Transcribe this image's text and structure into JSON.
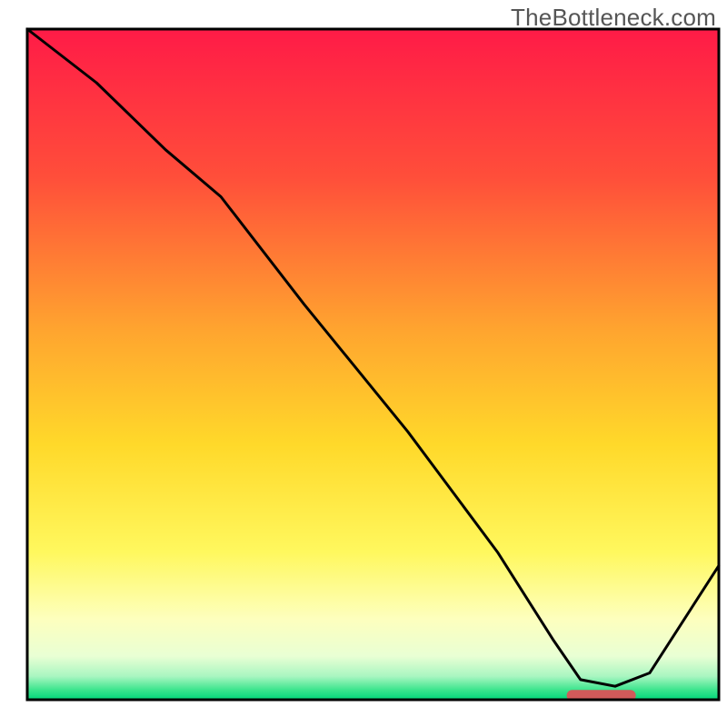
{
  "watermark": "TheBottleneck.com",
  "chart_data": {
    "type": "line",
    "title": "",
    "xlabel": "",
    "ylabel": "",
    "xlim": [
      0,
      100
    ],
    "ylim": [
      0,
      100
    ],
    "grid": false,
    "axes_visible": false,
    "background_gradient": {
      "stops": [
        {
          "offset": 0.0,
          "color": "#ff1b47"
        },
        {
          "offset": 0.22,
          "color": "#ff4e3a"
        },
        {
          "offset": 0.45,
          "color": "#ffa52f"
        },
        {
          "offset": 0.62,
          "color": "#ffd92a"
        },
        {
          "offset": 0.78,
          "color": "#fff85e"
        },
        {
          "offset": 0.88,
          "color": "#fdffbe"
        },
        {
          "offset": 0.935,
          "color": "#e9ffd4"
        },
        {
          "offset": 0.965,
          "color": "#a9f6c1"
        },
        {
          "offset": 0.985,
          "color": "#3de58e"
        },
        {
          "offset": 1.0,
          "color": "#00d67a"
        }
      ]
    },
    "series": [
      {
        "name": "bottleneck-curve",
        "color": "#000000",
        "width": 3,
        "x": [
          0,
          10,
          20,
          28,
          40,
          55,
          68,
          76,
          80,
          85,
          90,
          100
        ],
        "y": [
          100,
          92,
          82,
          75,
          59,
          40,
          22,
          9,
          3,
          2,
          4,
          20
        ]
      }
    ],
    "highlight_segment": {
      "color": "#d15a5a",
      "x_start": 78,
      "x_end": 88,
      "thickness": 12
    },
    "frame": {
      "visible": true,
      "color": "#000000",
      "inset_left": 30,
      "inset_right": 9,
      "inset_top": 32,
      "inset_bottom": 30
    }
  }
}
